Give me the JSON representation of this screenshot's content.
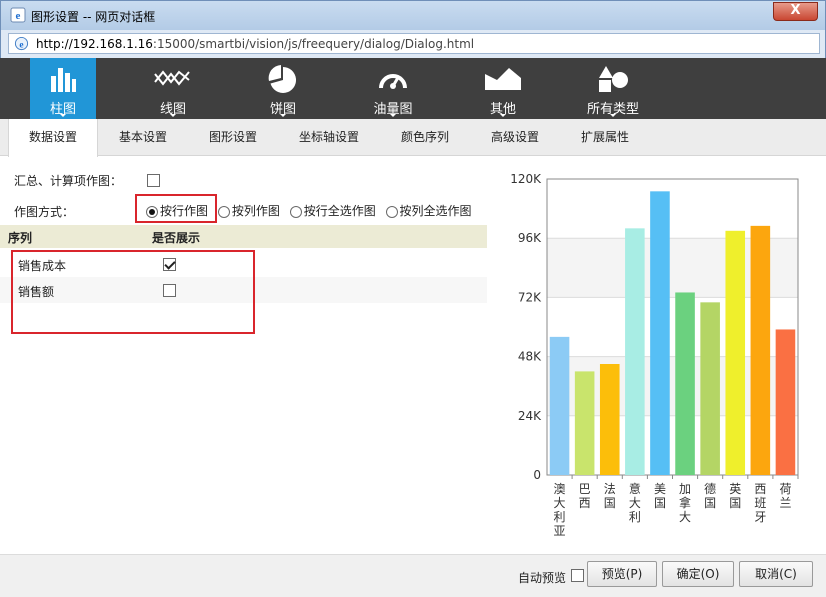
{
  "window": {
    "title": "图形设置 -- 网页对话框",
    "close_label": "X",
    "url_host": "http://192.168.1.16",
    "url_path": ":15000/smartbi/vision/js/freequery/dialog/Dialog.html"
  },
  "chart_types": [
    {
      "label": "柱图",
      "icon": "bar-chart-icon",
      "active": true
    },
    {
      "label": "线图",
      "icon": "line-chart-icon",
      "active": false
    },
    {
      "label": "饼图",
      "icon": "pie-chart-icon",
      "active": false
    },
    {
      "label": "油量图",
      "icon": "gauge-icon",
      "active": false
    },
    {
      "label": "其他",
      "icon": "area-chart-icon",
      "active": false
    },
    {
      "label": "所有类型",
      "icon": "all-types-icon",
      "active": false
    }
  ],
  "tabs": [
    {
      "label": "数据设置",
      "active": true
    },
    {
      "label": "基本设置"
    },
    {
      "label": "图形设置"
    },
    {
      "label": "坐标轴设置"
    },
    {
      "label": "颜色序列"
    },
    {
      "label": "高级设置"
    },
    {
      "label": "扩展属性"
    }
  ],
  "form": {
    "summary_label": "汇总、计算项作图：",
    "summary_checked": false,
    "mode_label": "作图方式：",
    "mode_options": [
      {
        "label": "按行作图",
        "checked": true
      },
      {
        "label": "按列作图",
        "checked": false
      },
      {
        "label": "按行全选作图",
        "checked": false
      },
      {
        "label": "按列全选作图",
        "checked": false
      }
    ]
  },
  "series_table": {
    "headers": [
      "序列",
      "是否展示"
    ],
    "rows": [
      {
        "name": "销售成本",
        "shown": true
      },
      {
        "name": "销售额",
        "shown": false
      }
    ]
  },
  "chart_data": {
    "type": "bar",
    "categories": [
      "澳大利亚",
      "巴西",
      "法国",
      "意大利",
      "美国",
      "加拿大",
      "德国",
      "英国",
      "西班牙",
      "荷兰"
    ],
    "values": [
      56000,
      42000,
      45000,
      100000,
      115000,
      74000,
      70000,
      99000,
      101000,
      59000
    ],
    "colors": [
      "#8ccbf5",
      "#c9e46c",
      "#fcbe0a",
      "#a8ede4",
      "#56bff5",
      "#6bd17f",
      "#b4d565",
      "#efef2c",
      "#fca60e",
      "#fa7043"
    ],
    "yticks": [
      "0",
      "24K",
      "48K",
      "72K",
      "96K",
      "120K"
    ],
    "ylim": [
      0,
      120000
    ],
    "grid": true
  },
  "bottom": {
    "autopreview_label": "自动预览",
    "autopreview_checked": false,
    "preview_label": "预览(P)",
    "ok_label": "确定(O)",
    "cancel_label": "取消(C)"
  }
}
